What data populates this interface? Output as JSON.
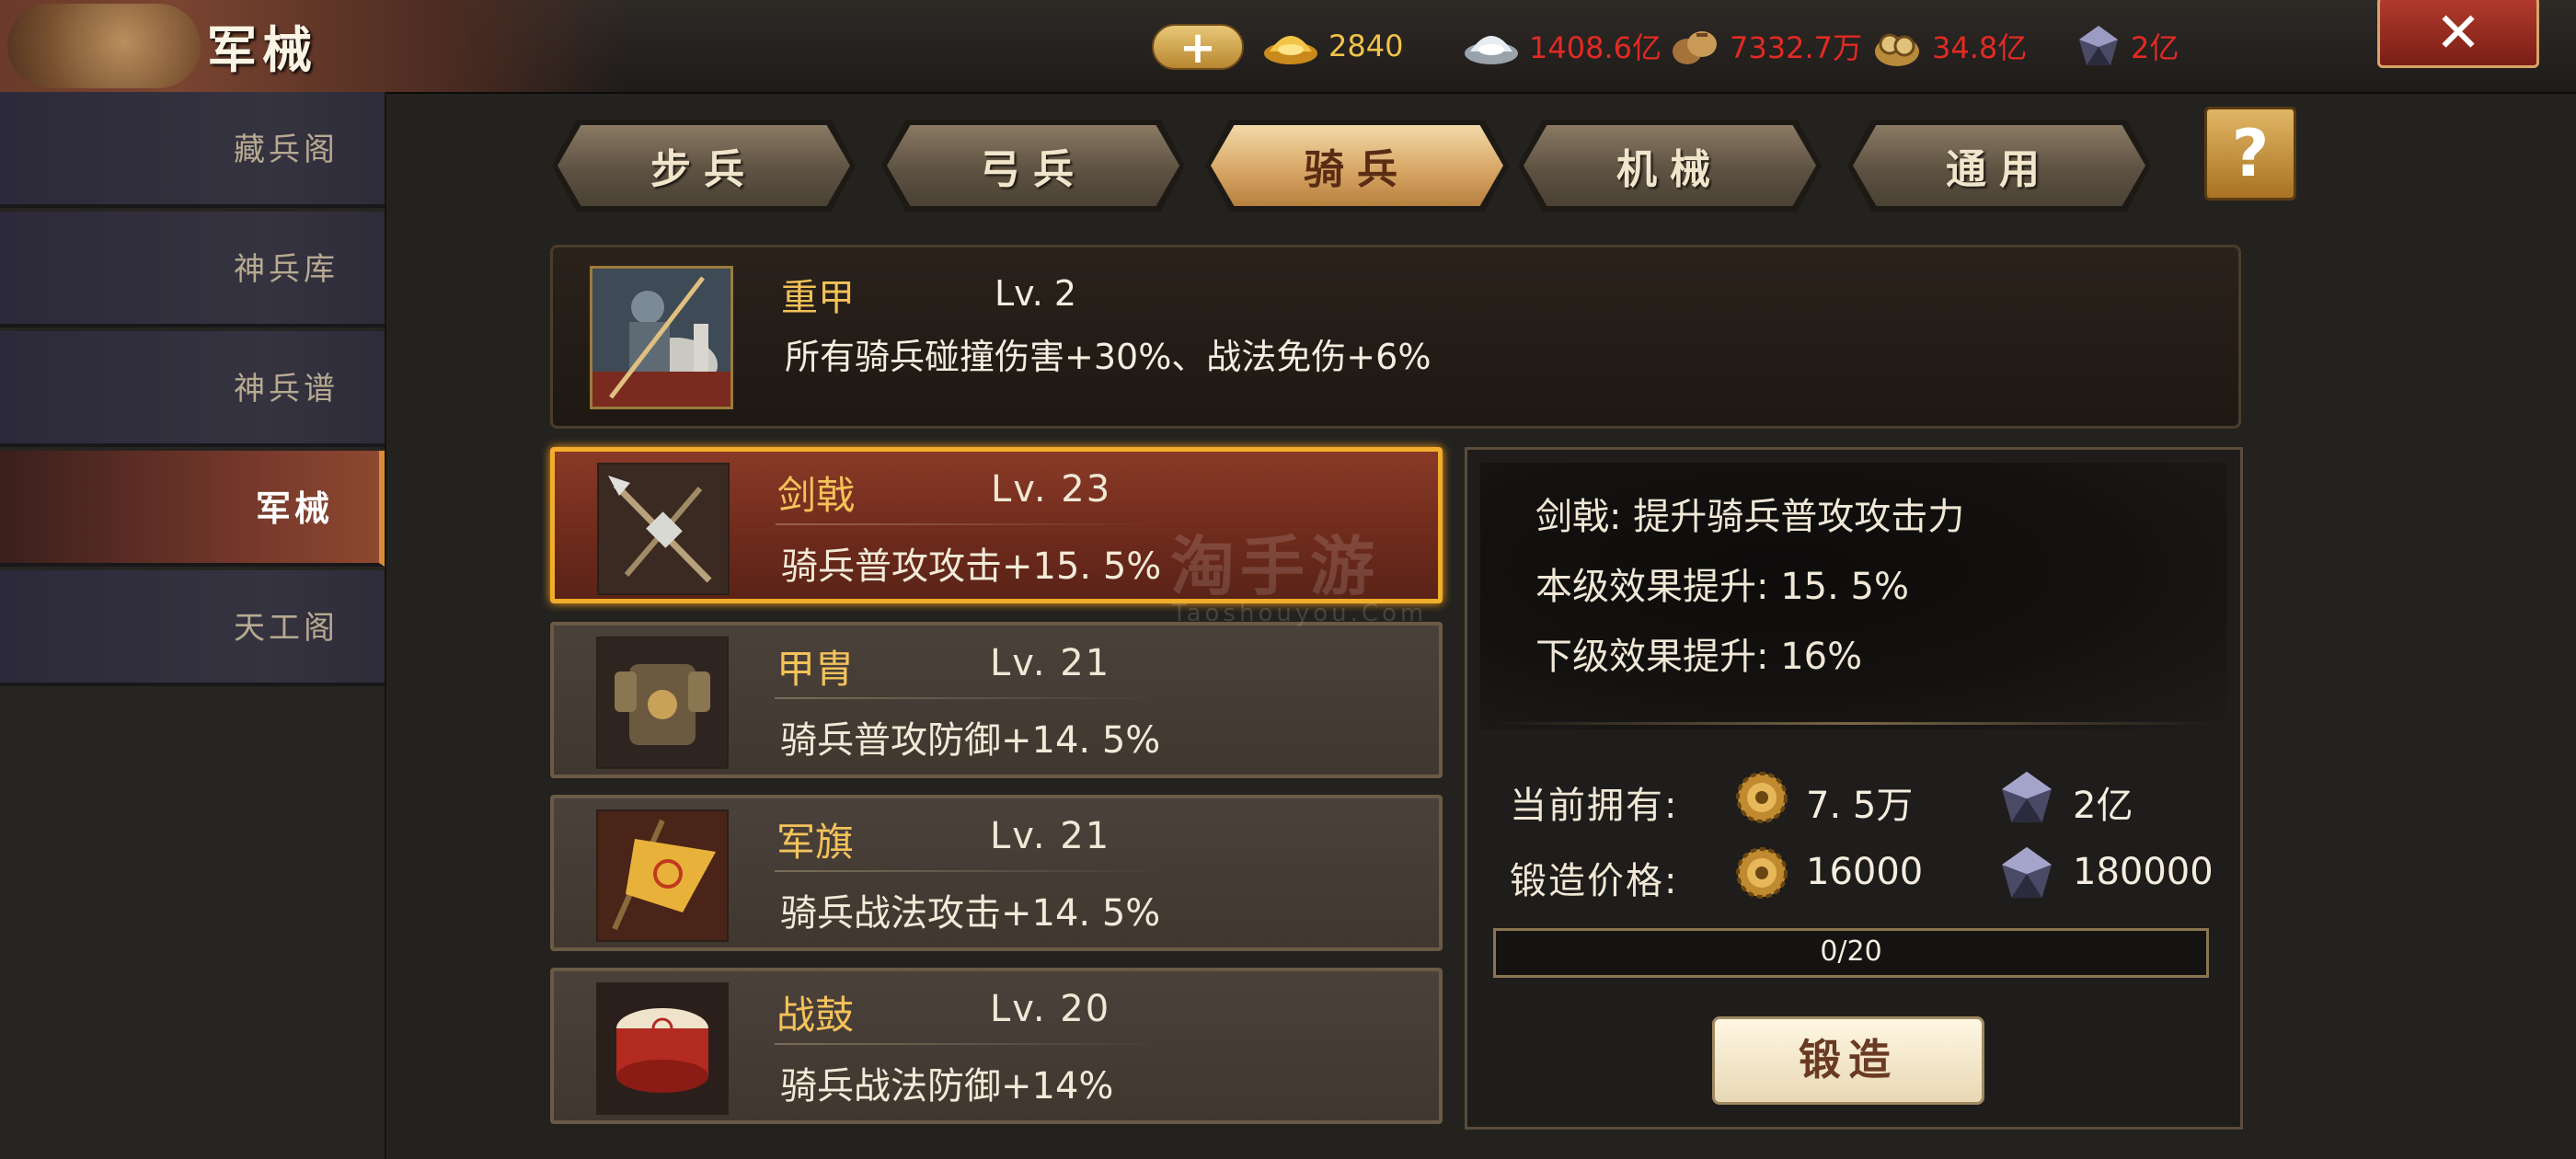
{
  "header": {
    "title": "军械",
    "recharge_label": "+",
    "resources": {
      "gold": "2840",
      "silver": "1408.6亿",
      "food": "7332.7万",
      "coin": "34.8亿",
      "crystal": "2亿"
    },
    "close_label": "✕"
  },
  "sidebar": {
    "items": [
      {
        "label": "藏兵阁",
        "active": false
      },
      {
        "label": "神兵库",
        "active": false
      },
      {
        "label": "神兵谱",
        "active": false
      },
      {
        "label": "军械",
        "active": true
      },
      {
        "label": "天工阁",
        "active": false
      }
    ]
  },
  "tabs": [
    {
      "label": "步兵",
      "active": false
    },
    {
      "label": "弓兵",
      "active": false
    },
    {
      "label": "骑兵",
      "active": true
    },
    {
      "label": "机械",
      "active": false
    },
    {
      "label": "通用",
      "active": false
    }
  ],
  "help_label": "?",
  "banner": {
    "name": "重甲",
    "level": "Lv. 2",
    "description": "所有骑兵碰撞伤害+30%、战法免伤+6%"
  },
  "equipment": [
    {
      "name": "剑戟",
      "level": "Lv. 23",
      "effect": "骑兵普攻攻击+15. 5%",
      "selected": true
    },
    {
      "name": "甲胄",
      "level": "Lv. 21",
      "effect": "骑兵普攻防御+14. 5%",
      "selected": false
    },
    {
      "name": "军旗",
      "level": "Lv. 21",
      "effect": "骑兵战法攻击+14. 5%",
      "selected": false
    },
    {
      "name": "战鼓",
      "level": "Lv. 20",
      "effect": "骑兵战法防御+14%",
      "selected": false
    }
  ],
  "detail": {
    "title": "剑戟:  提升骑兵普攻攻击力",
    "current_effect": "本级效果提升:  15. 5%",
    "next_effect": "下级效果提升:  16%",
    "owned_label": "当前拥有:",
    "owned_gear": "7. 5万",
    "owned_crystal": "2亿",
    "cost_label": "锻造价格:",
    "cost_gear": "16000",
    "cost_crystal": "180000",
    "progress_text": "0/20",
    "progress_fraction": 0,
    "forge_label": "锻造"
  },
  "watermark": {
    "main": "淘手游",
    "sub": "Taoshouyou.Com"
  }
}
